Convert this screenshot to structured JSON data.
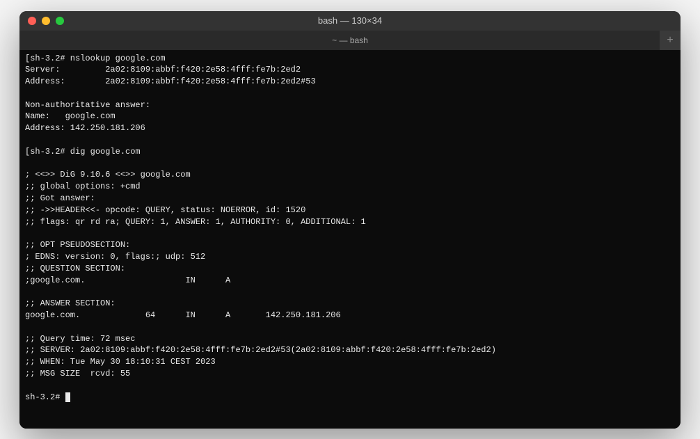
{
  "window": {
    "title": "bash — 130×34",
    "tab_title": "~ — bash",
    "new_tab_symbol": "+"
  },
  "terminal": {
    "lines": [
      "[sh-3.2# nslookup google.com",
      "Server:         2a02:8109:abbf:f420:2e58:4fff:fe7b:2ed2",
      "Address:        2a02:8109:abbf:f420:2e58:4fff:fe7b:2ed2#53",
      "",
      "Non-authoritative answer:",
      "Name:   google.com",
      "Address: 142.250.181.206",
      "",
      "[sh-3.2# dig google.com",
      "",
      "; <<>> DiG 9.10.6 <<>> google.com",
      ";; global options: +cmd",
      ";; Got answer:",
      ";; ->>HEADER<<- opcode: QUERY, status: NOERROR, id: 1520",
      ";; flags: qr rd ra; QUERY: 1, ANSWER: 1, AUTHORITY: 0, ADDITIONAL: 1",
      "",
      ";; OPT PSEUDOSECTION:",
      "; EDNS: version: 0, flags:; udp: 512",
      ";; QUESTION SECTION:",
      ";google.com.                    IN      A",
      "",
      ";; ANSWER SECTION:",
      "google.com.             64      IN      A       142.250.181.206",
      "",
      ";; Query time: 72 msec",
      ";; SERVER: 2a02:8109:abbf:f420:2e58:4fff:fe7b:2ed2#53(2a02:8109:abbf:f420:2e58:4fff:fe7b:2ed2)",
      ";; WHEN: Tue May 30 18:10:31 CEST 2023",
      ";; MSG SIZE  rcvd: 55",
      "",
      "sh-3.2# "
    ]
  }
}
